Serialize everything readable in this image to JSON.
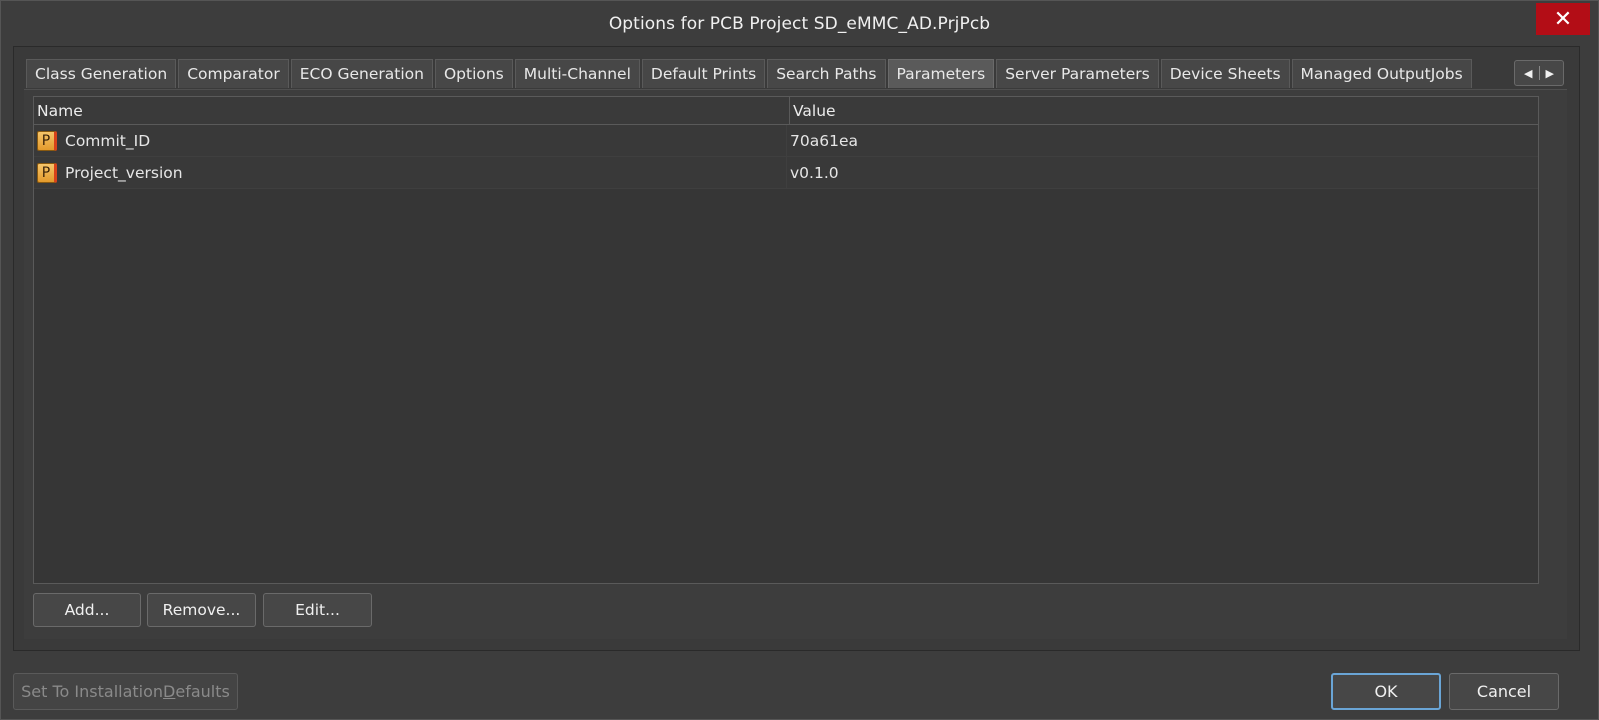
{
  "window": {
    "title": "Options for PCB Project SD_eMMC_AD.PrjPcb",
    "close_glyph": "✕"
  },
  "tabs": [
    {
      "label": "Class Generation"
    },
    {
      "label": "Comparator"
    },
    {
      "label": "ECO Generation"
    },
    {
      "label": "Options"
    },
    {
      "label": "Multi-Channel"
    },
    {
      "label": "Default Prints"
    },
    {
      "label": "Search Paths"
    },
    {
      "label": "Parameters"
    },
    {
      "label": "Server Parameters"
    },
    {
      "label": "Device Sheets"
    },
    {
      "label": "Managed OutputJobs"
    }
  ],
  "active_tab": "Parameters",
  "tab_scroll": {
    "left": "◀",
    "right": "▶"
  },
  "grid": {
    "columns": {
      "name": "Name",
      "value": "Value"
    },
    "rows": [
      {
        "icon": "parameter-icon",
        "icon_glyph": "P",
        "name": "Commit_ID",
        "value": "70a61ea"
      },
      {
        "icon": "parameter-icon",
        "icon_glyph": "P",
        "name": "Project_version",
        "value": "v0.1.0"
      }
    ]
  },
  "buttons": {
    "add": "Add...",
    "remove": "Remove...",
    "edit": "Edit..."
  },
  "footer": {
    "defaults_prefix": "Set To Installation ",
    "defaults_underlined": "D",
    "defaults_suffix": "efaults",
    "ok": "OK",
    "cancel": "Cancel"
  },
  "colors": {
    "background": "#3d3d3d",
    "close_button": "#b30d16",
    "ok_focus_border": "#6aa5d6",
    "parameter_icon": "#e39a2c"
  }
}
